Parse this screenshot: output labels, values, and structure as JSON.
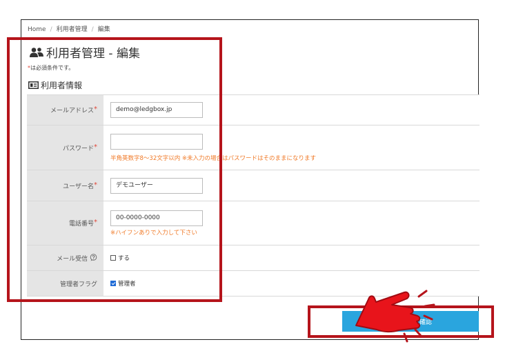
{
  "breadcrumb": {
    "items": [
      "Home",
      "利用者管理",
      "編集"
    ]
  },
  "page": {
    "title": "利用者管理 - 編集",
    "required_star": "*",
    "required_note": "は必須条件です。",
    "section_title": "利用者情報"
  },
  "form": {
    "email_label": "メールアドレス",
    "email_value": "demo@ledgbox.jp",
    "password_label": "パスワード",
    "password_value": "",
    "password_hint": "半角英数字8～32文字以内 ※未入力の場合はパスワードはそのままになります",
    "username_label": "ユーザー名",
    "username_value": "デモユーザー",
    "phone_label": "電話番号",
    "phone_value": "00-0000-0000",
    "phone_hint": "※ハイフンありで入力して下さい",
    "mail_label": "メール受信",
    "mail_option": "する",
    "mail_checked": false,
    "admin_label": "管理者フラグ",
    "admin_option": "管理者",
    "admin_checked": true
  },
  "actions": {
    "confirm_label": "確認"
  },
  "colors": {
    "required": "#e0483a",
    "hint": "#f07a28",
    "button": "#2aa5de",
    "highlight": "#b5141b",
    "pointer": "#e8141b"
  },
  "icons": [
    "users-icon",
    "id-card-icon",
    "help-icon",
    "pointing-hand-icon"
  ]
}
